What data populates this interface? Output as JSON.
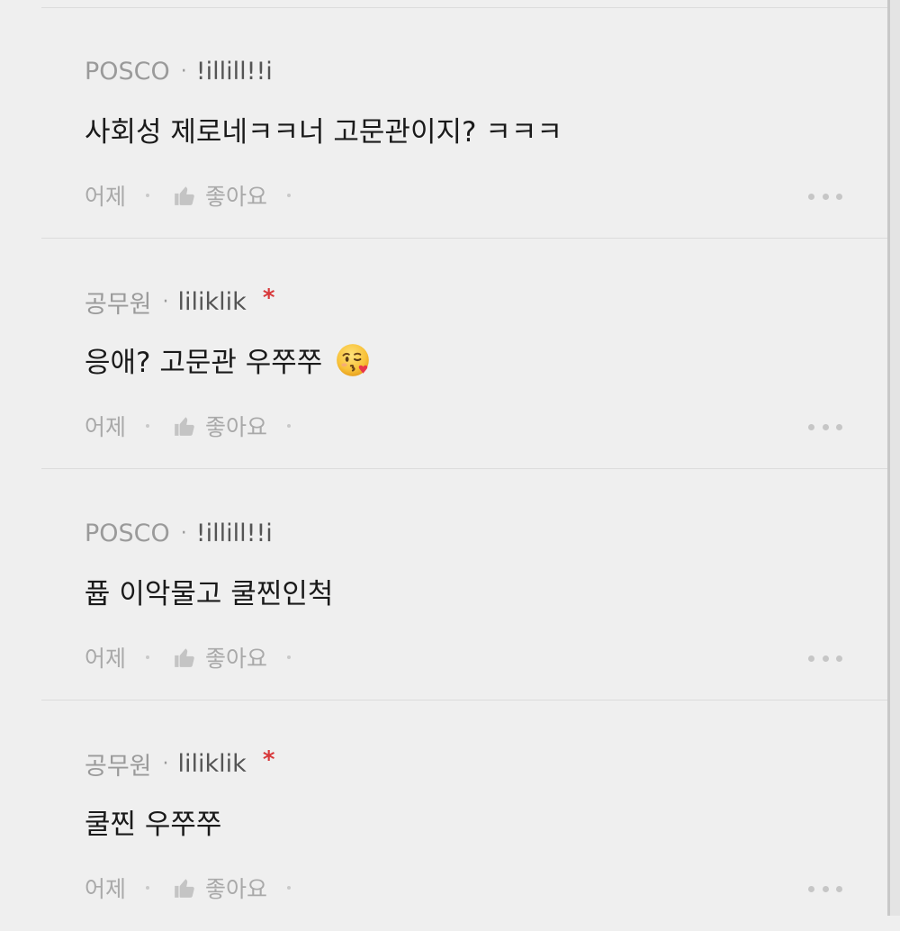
{
  "comments": [
    {
      "company": "POSCO",
      "separator": "·",
      "nickname": "!illill!!i",
      "author_mark": "",
      "text": "사회성 제로네ㅋㅋ너 고문관이지? ㅋㅋㅋ",
      "emoji": "",
      "time": "어제",
      "like_label": "좋아요"
    },
    {
      "company": "공무원",
      "separator": "·",
      "nickname": "liliklik",
      "author_mark": "*",
      "text": "응애? 고문관 우쭈쭈",
      "emoji": "kissing-face-with-heart-emoji",
      "time": "어제",
      "like_label": "좋아요"
    },
    {
      "company": "POSCO",
      "separator": "·",
      "nickname": "!illill!!i",
      "author_mark": "",
      "text": "퓹 이악물고 쿨찐인척",
      "emoji": "",
      "time": "어제",
      "like_label": "좋아요"
    },
    {
      "company": "공무원",
      "separator": "·",
      "nickname": "liliklik",
      "author_mark": "*",
      "text": "쿨찐 우쭈쭈",
      "emoji": "",
      "time": "어제",
      "like_label": "좋아요"
    }
  ],
  "icons": {
    "like": "thumbs-up-icon",
    "more": "more-dots-icon"
  },
  "colors": {
    "background": "#efefef",
    "author_mark": "#d8393b",
    "muted_text": "#a9a9a9",
    "body_text": "#1a1a1a"
  }
}
